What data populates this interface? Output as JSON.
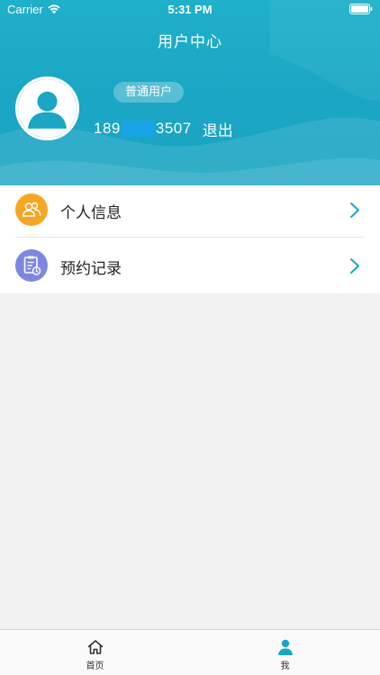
{
  "status_bar": {
    "carrier": "Carrier",
    "time": "5:31 PM"
  },
  "nav": {
    "title": "用户中心"
  },
  "profile": {
    "role": "普通用户",
    "phone_prefix": "189",
    "phone_suffix": "3507",
    "logout_label": "退出"
  },
  "menu": {
    "items": [
      {
        "label": "个人信息",
        "icon": "people-icon",
        "color": "#f5a623"
      },
      {
        "label": "预约记录",
        "icon": "clipboard-clock-icon",
        "color": "#7e87e0"
      }
    ]
  },
  "tabbar": {
    "items": [
      {
        "label": "首页",
        "icon": "home-icon",
        "active": false
      },
      {
        "label": "我",
        "icon": "person-icon",
        "active": true
      }
    ],
    "active_color": "#1aa6c4"
  },
  "colors": {
    "header": "#1aa6c4",
    "accent": "#1aa6c4"
  }
}
